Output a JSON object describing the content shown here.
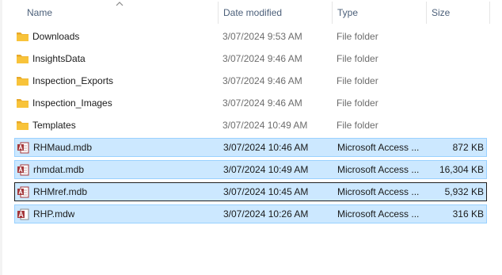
{
  "columns": {
    "name": "Name",
    "date_modified": "Date modified",
    "type": "Type",
    "size": "Size"
  },
  "sort": {
    "column": "name",
    "direction": "ascending"
  },
  "files": [
    {
      "name": "Downloads",
      "date": "3/07/2024 9:53 AM",
      "type": "File folder",
      "size": "",
      "icon": "folder-icon",
      "selected": false
    },
    {
      "name": "InsightsData",
      "date": "3/07/2024 9:46 AM",
      "type": "File folder",
      "size": "",
      "icon": "folder-icon",
      "selected": false
    },
    {
      "name": "Inspection_Exports",
      "date": "3/07/2024 9:46 AM",
      "type": "File folder",
      "size": "",
      "icon": "folder-icon",
      "selected": false
    },
    {
      "name": "Inspection_Images",
      "date": "3/07/2024 9:46 AM",
      "type": "File folder",
      "size": "",
      "icon": "folder-icon",
      "selected": false
    },
    {
      "name": "Templates",
      "date": "3/07/2024 10:49 AM",
      "type": "File folder",
      "size": "",
      "icon": "folder-icon",
      "selected": false
    },
    {
      "name": "RHMaud.mdb",
      "date": "3/07/2024 10:46 AM",
      "type": "Microsoft Access ...",
      "size": "872 KB",
      "icon": "access-database-icon",
      "selected": true
    },
    {
      "name": "rhmdat.mdb",
      "date": "3/07/2024 10:49 AM",
      "type": "Microsoft Access ...",
      "size": "16,304 KB",
      "icon": "access-database-icon",
      "selected": true
    },
    {
      "name": "RHMref.mdb",
      "date": "3/07/2024 10:45 AM",
      "type": "Microsoft Access ...",
      "size": "5,932 KB",
      "icon": "access-database-icon",
      "selected": true,
      "focused": true
    },
    {
      "name": "RHP.mdw",
      "date": "3/07/2024 10:26 AM",
      "type": "Microsoft Access ...",
      "size": "316 KB",
      "icon": "access-workgroup-icon",
      "selected": true
    }
  ],
  "colors": {
    "selection_fill": "#cce8ff",
    "selection_border": "#99d1ff",
    "focus_border": "#1f1f1f",
    "folder_yellow": "#f8c33a",
    "access_red": "#a4373a",
    "header_text": "#4c607a"
  }
}
